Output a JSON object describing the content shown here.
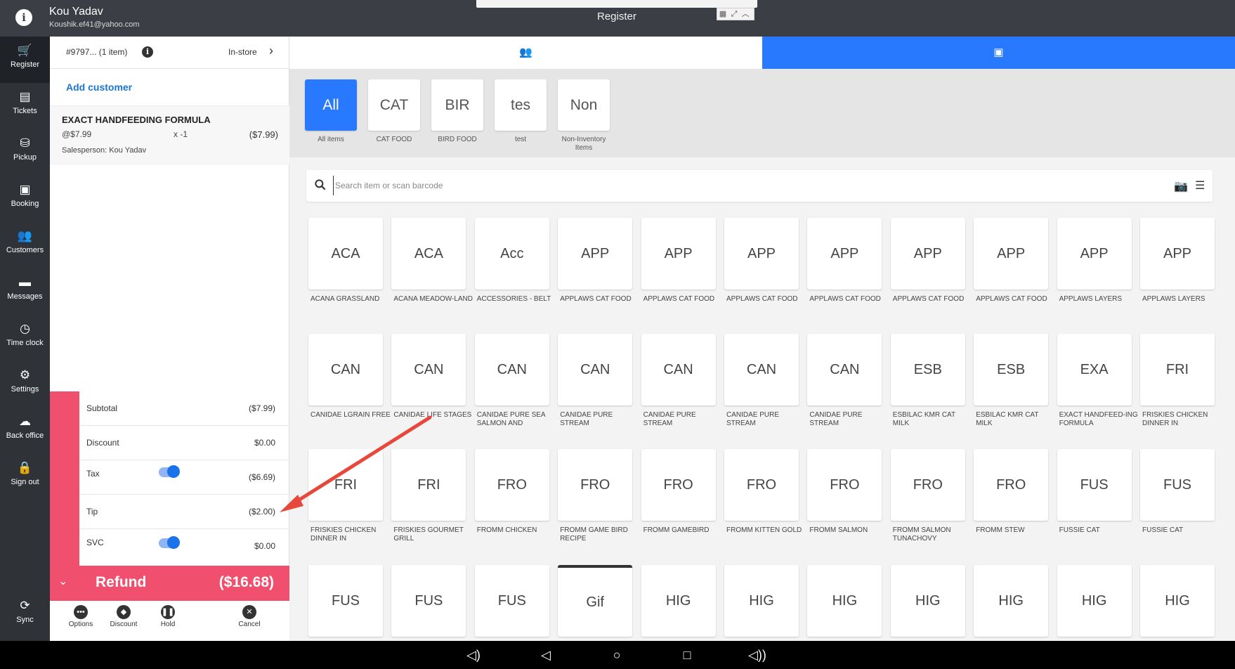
{
  "topbar": {
    "user_name": "Kou Yadav",
    "user_email": "Koushik.ef41@yahoo.com",
    "title": "Register"
  },
  "sidenav": [
    {
      "label": "Register",
      "icon": "cart-icon",
      "glyph": "🛒",
      "active": true
    },
    {
      "label": "Tickets",
      "icon": "tickets-icon",
      "glyph": "▤"
    },
    {
      "label": "Pickup",
      "icon": "pickup-icon",
      "glyph": "⛁"
    },
    {
      "label": "Booking",
      "icon": "calendar-icon",
      "glyph": "▣"
    },
    {
      "label": "Customers",
      "icon": "customers-icon",
      "glyph": "👥"
    },
    {
      "label": "Messages",
      "icon": "messages-icon",
      "glyph": "▬"
    },
    {
      "label": "Time clock",
      "icon": "clock-icon",
      "glyph": "◷"
    },
    {
      "label": "Settings",
      "icon": "gear-icon",
      "glyph": "⚙"
    },
    {
      "label": "Back office",
      "icon": "cloud-icon",
      "glyph": "☁"
    },
    {
      "label": "Sign out",
      "icon": "lock-icon",
      "glyph": "🔒"
    },
    {
      "label": "Sync",
      "icon": "sync-icon",
      "glyph": "⟳"
    }
  ],
  "order": {
    "number": "#9797... (1 item)",
    "channel": "In-store",
    "add_customer": "Add customer",
    "item": {
      "name": "EXACT HANDFEEDING FORMULA",
      "unit_price": "@$7.99",
      "qty": "x  -1",
      "amount": "($7.99)",
      "salesperson": "Salesperson: Kou Yadav"
    }
  },
  "totals": {
    "subtotal_label": "Subtotal",
    "subtotal": "($7.99)",
    "discount_label": "Discount",
    "discount": "$0.00",
    "tax_label": "Tax",
    "tax": "($6.69)",
    "tip_label": "Tip",
    "tip": "($2.00)",
    "svc_label": "SVC",
    "svc": "$0.00"
  },
  "refund": {
    "label": "Refund",
    "amount": "($16.68)"
  },
  "actions": {
    "options": "Options",
    "discount": "Discount",
    "hold": "Hold",
    "cancel": "Cancel"
  },
  "categories": [
    {
      "code": "All",
      "name": "All items",
      "active": true
    },
    {
      "code": "CAT",
      "name": "CAT FOOD"
    },
    {
      "code": "BIR",
      "name": "BIRD FOOD"
    },
    {
      "code": "tes",
      "name": "test"
    },
    {
      "code": "Non",
      "name": "Non-Inventory Items"
    }
  ],
  "search": {
    "placeholder": "Search item or scan barcode"
  },
  "items": [
    {
      "code": "ACA",
      "name": "ACANA GRASSLAND"
    },
    {
      "code": "ACA",
      "name": "ACANA MEADOW-LAND"
    },
    {
      "code": "Acc",
      "name": "Accessories - Belt"
    },
    {
      "code": "APP",
      "name": "APPLAWS CAT FOOD"
    },
    {
      "code": "APP",
      "name": "APPLAWS CAT FOOD"
    },
    {
      "code": "APP",
      "name": "APPLAWS CAT FOOD"
    },
    {
      "code": "APP",
      "name": "APPLAWS CAT FOOD"
    },
    {
      "code": "APP",
      "name": "APPLAWS CAT FOOD"
    },
    {
      "code": "APP",
      "name": "APPLAWS CAT FOOD"
    },
    {
      "code": "APP",
      "name": "APPLAWS LAYERS"
    },
    {
      "code": "APP",
      "name": "APPLAWS LAYERS"
    },
    {
      "code": "CAN",
      "name": "CANIDAE LGRAIN FREE"
    },
    {
      "code": "CAN",
      "name": "CANIDAE LIFE STAGES"
    },
    {
      "code": "CAN",
      "name": "CANIDAE PURE SEA SALMON AND"
    },
    {
      "code": "CAN",
      "name": "CANIDAE PURE STREAM"
    },
    {
      "code": "CAN",
      "name": "CANIDAE PURE STREAM"
    },
    {
      "code": "CAN",
      "name": "CANIDAE PURE STREAM"
    },
    {
      "code": "CAN",
      "name": "CANIDAE PURE STREAM"
    },
    {
      "code": "ESB",
      "name": "ESBILAC KMR CAT MILK"
    },
    {
      "code": "ESB",
      "name": "ESBILAC KMR CAT MILK"
    },
    {
      "code": "EXA",
      "name": "EXACT HANDFEED-ING FORMULA"
    },
    {
      "code": "FRI",
      "name": "FRISKIES CHICKEN DINNER IN"
    },
    {
      "code": "FRI",
      "name": "FRISKIES CHICKEN DINNER IN"
    },
    {
      "code": "FRI",
      "name": "FRISKIES GOURMET GRILL"
    },
    {
      "code": "FRO",
      "name": "FROMM CHICKEN"
    },
    {
      "code": "FRO",
      "name": "FROMM GAME BIRD RECIPE"
    },
    {
      "code": "FRO",
      "name": "FROMM GAMEBIRD"
    },
    {
      "code": "FRO",
      "name": "FROMM KITTEN GOLD"
    },
    {
      "code": "FRO",
      "name": "FROMM SALMON"
    },
    {
      "code": "FRO",
      "name": "FROMM SALMON TUNACHOVY"
    },
    {
      "code": "FRO",
      "name": "FROMM STEW"
    },
    {
      "code": "FUS",
      "name": "FUSSIE CAT"
    },
    {
      "code": "FUS",
      "name": "FUSSIE CAT"
    },
    {
      "code": "FUS",
      "name": ""
    },
    {
      "code": "FUS",
      "name": ""
    },
    {
      "code": "FUS",
      "name": ""
    },
    {
      "code": "Gif",
      "name": "",
      "selected": true
    },
    {
      "code": "HIG",
      "name": ""
    },
    {
      "code": "HIG",
      "name": ""
    },
    {
      "code": "HIG",
      "name": ""
    },
    {
      "code": "HIG",
      "name": ""
    },
    {
      "code": "HIG",
      "name": ""
    },
    {
      "code": "HIG",
      "name": ""
    },
    {
      "code": "HIG",
      "name": ""
    }
  ],
  "colors": {
    "accent": "#2979ff",
    "refund": "#f0506e",
    "annotation_arrow": "#e8473b"
  }
}
